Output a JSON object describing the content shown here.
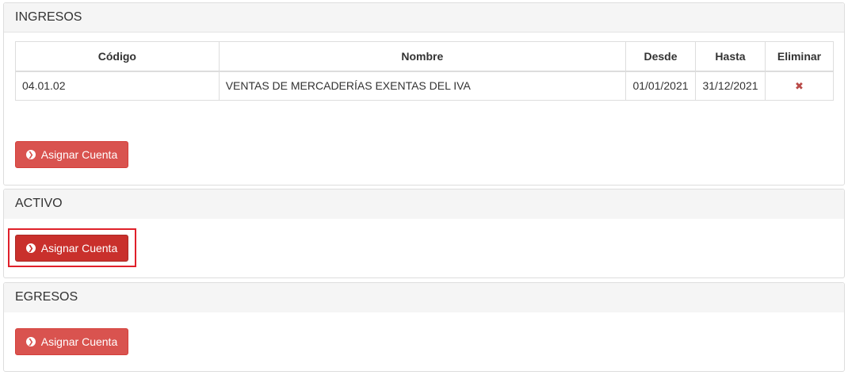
{
  "sections": {
    "ingresos": {
      "title": "INGRESOS",
      "table": {
        "headers": {
          "codigo": "Código",
          "nombre": "Nombre",
          "desde": "Desde",
          "hasta": "Hasta",
          "eliminar": "Eliminar"
        },
        "rows": [
          {
            "codigo": "04.01.02",
            "nombre": "VENTAS DE MERCADERÍAS EXENTAS DEL IVA",
            "desde": "01/01/2021",
            "hasta": "31/12/2021",
            "eliminar_icon": "✖"
          }
        ]
      },
      "button_label": "Asignar Cuenta"
    },
    "activo": {
      "title": "ACTIVO",
      "button_label": "Asignar Cuenta"
    },
    "egresos": {
      "title": "EGRESOS",
      "button_label": "Asignar Cuenta"
    }
  },
  "icons": {
    "button_icon": "chevron-circle-right-icon",
    "delete_icon": "times-icon"
  },
  "colors": {
    "button": "#d9534f",
    "button_active": "#c9302c",
    "delete": "#b94a48",
    "highlight": "#e0202a"
  }
}
